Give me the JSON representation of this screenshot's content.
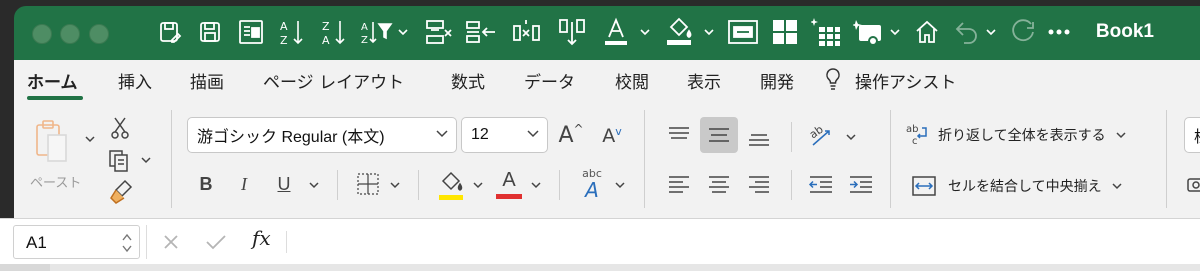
{
  "window": {
    "title": "Book1"
  },
  "tabs": [
    {
      "label": "ホーム",
      "active": true
    },
    {
      "label": "挿入"
    },
    {
      "label": "描画"
    },
    {
      "label": "ページ レイアウト"
    },
    {
      "label": "数式"
    },
    {
      "label": "データ"
    },
    {
      "label": "校閲"
    },
    {
      "label": "表示"
    },
    {
      "label": "開発"
    },
    {
      "label": "操作アシスト"
    }
  ],
  "clipboard": {
    "paste_label": "ペースト"
  },
  "font": {
    "family_value": "游ゴシック Regular (本文)",
    "size_value": "12",
    "grow_label": "A",
    "shrink_label": "A",
    "bold": "B",
    "italic": "I",
    "underline": "U",
    "font_color_letter": "A",
    "fill_color": "#ffe600",
    "font_color": "#e03030",
    "phonetic_label": "abc"
  },
  "alignment": {
    "wrap_text_label": "折り返して全体を表示する",
    "merge_center_label": "セルを結合して中央揃え"
  },
  "number": {
    "format_partial": "標"
  },
  "formula_bar": {
    "cell_ref": "A1",
    "fx_label": "fx",
    "formula_value": ""
  },
  "colors": {
    "brand": "#217346",
    "ribbon_bg": "#f2f2f2",
    "pressed": "#c9c9c9"
  }
}
